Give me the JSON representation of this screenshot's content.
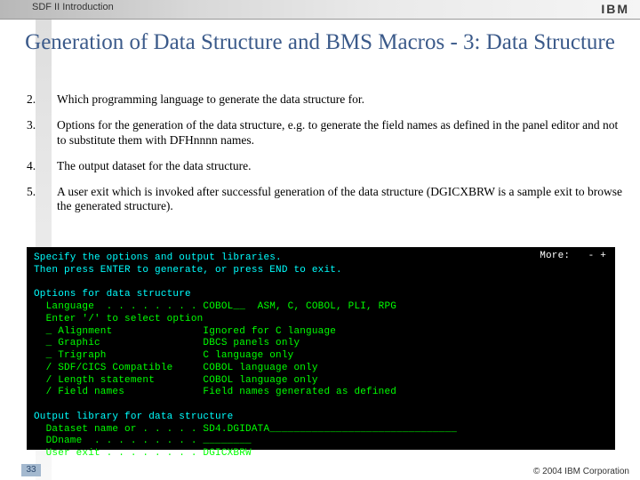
{
  "header": {
    "product": "SDF II  Introduction",
    "logo": "IBM"
  },
  "title": "Generation of Data Structure and BMS Macros - 3: Data Structure",
  "items": [
    {
      "num": "2.",
      "text": "Which programming language to generate the data structure for."
    },
    {
      "num": "3.",
      "text": "Options for the generation of the data structure, e.g. to generate the field names as defined in the panel editor and not to substitute them with DFHnnnn names."
    },
    {
      "num": "4.",
      "text": "The output dataset for the data structure."
    },
    {
      "num": "5.",
      "text": "A user exit which is invoked after successful generation of the data structure (DGICXBRW is a sample exit to browse the generated structure)."
    }
  ],
  "terminal": {
    "more": "More:   - +",
    "lines": [
      "Specify the options and output libraries.",
      "Then press ENTER to generate, or press END to exit.",
      "",
      "Options for data structure",
      "  Language  . . . . . . . . COBOL__  ASM, C, COBOL, PLI, RPG",
      "  Enter '/' to select option",
      "  _ Alignment               Ignored for C language",
      "  _ Graphic                 DBCS panels only",
      "  _ Trigraph                C language only",
      "  / SDF/CICS Compatible     COBOL language only",
      "  / Length statement        COBOL language only",
      "  / Field names             Field names generated as defined",
      "",
      "Output library for data structure",
      "  Dataset name or . . . . . SD4.DGIDATA_______________________________",
      "  DDname  . . . . . . . . . ________",
      "  User exit . . . . . . . . DGICXBRW"
    ]
  },
  "footer": {
    "page": "33",
    "copyright": "© 2004 IBM Corporation"
  }
}
